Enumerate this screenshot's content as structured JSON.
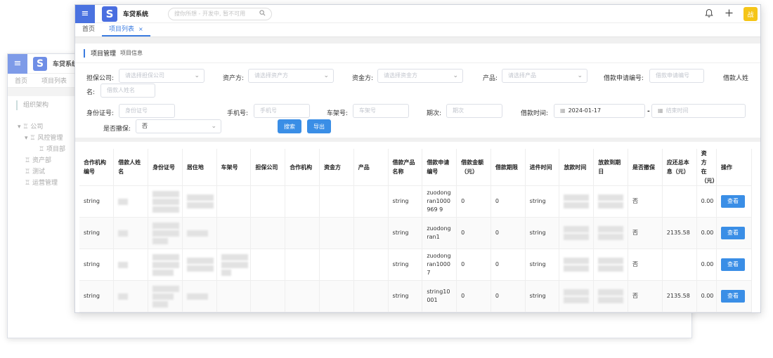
{
  "app": {
    "title": "车贷系统",
    "logo_letter": "S",
    "menu_glyph": "≡",
    "search_placeholder": "搜你所想 - 开发中, 暂不可用",
    "avatar_text": "战"
  },
  "back_window": {
    "title": "车贷系统",
    "tabs": [
      "首页",
      "项目列表"
    ],
    "section": "组织架构",
    "tree": [
      {
        "label": "公司",
        "prefix": "▾ ♖ ",
        "indent": 0
      },
      {
        "label": "风控管理",
        "prefix": "▾ ♖ ",
        "indent": 1
      },
      {
        "label": "项目部",
        "prefix": "♖ ",
        "indent": 3
      },
      {
        "label": "资产部",
        "prefix": "♖ ",
        "indent": 1
      },
      {
        "label": "测试",
        "prefix": "♖ ",
        "indent": 1
      },
      {
        "label": "运营管理",
        "prefix": "♖ ",
        "indent": 1
      }
    ]
  },
  "tabs": {
    "home": "首页",
    "project_list": "项目列表",
    "close_glyph": "×"
  },
  "section": {
    "title": "项目管理",
    "subtitle": "项目信息"
  },
  "filters": {
    "guarantee_label": "担保公司:",
    "guarantee_ph": "请选择担保公司",
    "asset_label": "资产方:",
    "asset_ph": "请选择资产方",
    "fund_label": "资金方:",
    "fund_ph": "请选择资金方",
    "product_label": "产品:",
    "product_ph": "请选择产品",
    "apply_no_label": "借款申请编号:",
    "apply_no_ph": "借款申请编号",
    "borrower_label_1": "借款人姓",
    "borrower_label_2": "名:",
    "borrower_ph": "借款人姓名",
    "idcard_label": "身份证号:",
    "idcard_ph": "身份证号",
    "phone_label": "手机号:",
    "phone_ph": "手机号",
    "frame_label": "车架号:",
    "frame_ph": "车架号",
    "period_label": "期次:",
    "period_ph": "期次",
    "loan_time_label": "借款时间:",
    "loan_time_start": "2024-01-17",
    "loan_time_sep": "-",
    "loan_time_end_ph": "结束时间",
    "withdraw_label": "是否撤保:",
    "withdraw_value": "否",
    "search_btn": "搜索",
    "export_btn": "导出"
  },
  "table": {
    "headers": [
      "合作机构编号",
      "借款人姓名",
      "身份证号",
      "居住地",
      "车架号",
      "担保公司",
      "合作机构",
      "资金方",
      "产品",
      "借款产品名称",
      "借款申请编号",
      "借款金额（元）",
      "借款期限",
      "进件时间",
      "放款时间",
      "放款到期日",
      "是否撤保",
      "应还总本息（元）",
      "资方在（元）",
      "操作"
    ],
    "action_label": "查看",
    "rows": [
      {
        "org_no": "string",
        "product_name": "string",
        "apply_no": "zuodongran1000969 9",
        "amount": "0",
        "term": "0",
        "entry_time": "string",
        "withdraw": "否",
        "total_due": "",
        "fund_remain": "0.00"
      },
      {
        "org_no": "string",
        "product_name": "string",
        "apply_no": "zuodongran1",
        "amount": "0",
        "term": "0",
        "entry_time": "string",
        "withdraw": "否",
        "total_due": "2135.58",
        "fund_remain": "0.00"
      },
      {
        "org_no": "string",
        "product_name": "string",
        "apply_no": "zuodongran10007",
        "amount": "0",
        "term": "0",
        "entry_time": "string",
        "withdraw": "否",
        "total_due": "",
        "fund_remain": "0.00"
      },
      {
        "org_no": "string",
        "product_name": "string",
        "apply_no": "string10001",
        "amount": "0",
        "term": "0",
        "entry_time": "string",
        "withdraw": "否",
        "total_due": "2135.58",
        "fund_remain": "0.00"
      }
    ]
  }
}
